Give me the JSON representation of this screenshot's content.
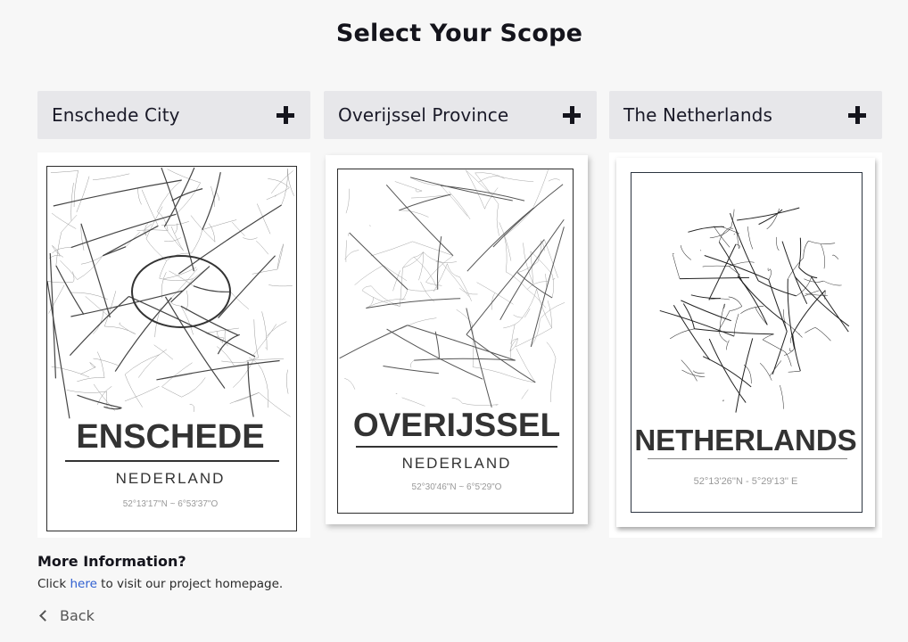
{
  "page": {
    "title": "Select Your Scope"
  },
  "scopes": [
    {
      "label": "Enschede City",
      "icon": "plus-icon",
      "poster": {
        "city": "ENSCHEDE",
        "country": "NEDERLAND",
        "coords": "52°13'17\"N ~ 6°53'37\"O"
      }
    },
    {
      "label": "Overijssel Province",
      "icon": "plus-icon",
      "poster": {
        "city": "OVERIJSSEL",
        "country": "NEDERLAND",
        "coords": "52°30'46\"N ~ 6°5'29\"O"
      }
    },
    {
      "label": "The Netherlands",
      "icon": "plus-icon",
      "poster": {
        "city": "NETHERLANDS",
        "country": "",
        "coords": "52°13'26''N - 5°29'13'' E"
      }
    }
  ],
  "info": {
    "title": "More Information?",
    "text_before": "Click ",
    "link_text": "here",
    "text_after": " to visit our project homepage."
  },
  "nav": {
    "back_label": "Back",
    "back_icon": "chevron-left-icon"
  },
  "colors": {
    "header_bg": "#e7e7ea",
    "page_bg": "#f7f7f7",
    "link": "#2f5fd0"
  }
}
